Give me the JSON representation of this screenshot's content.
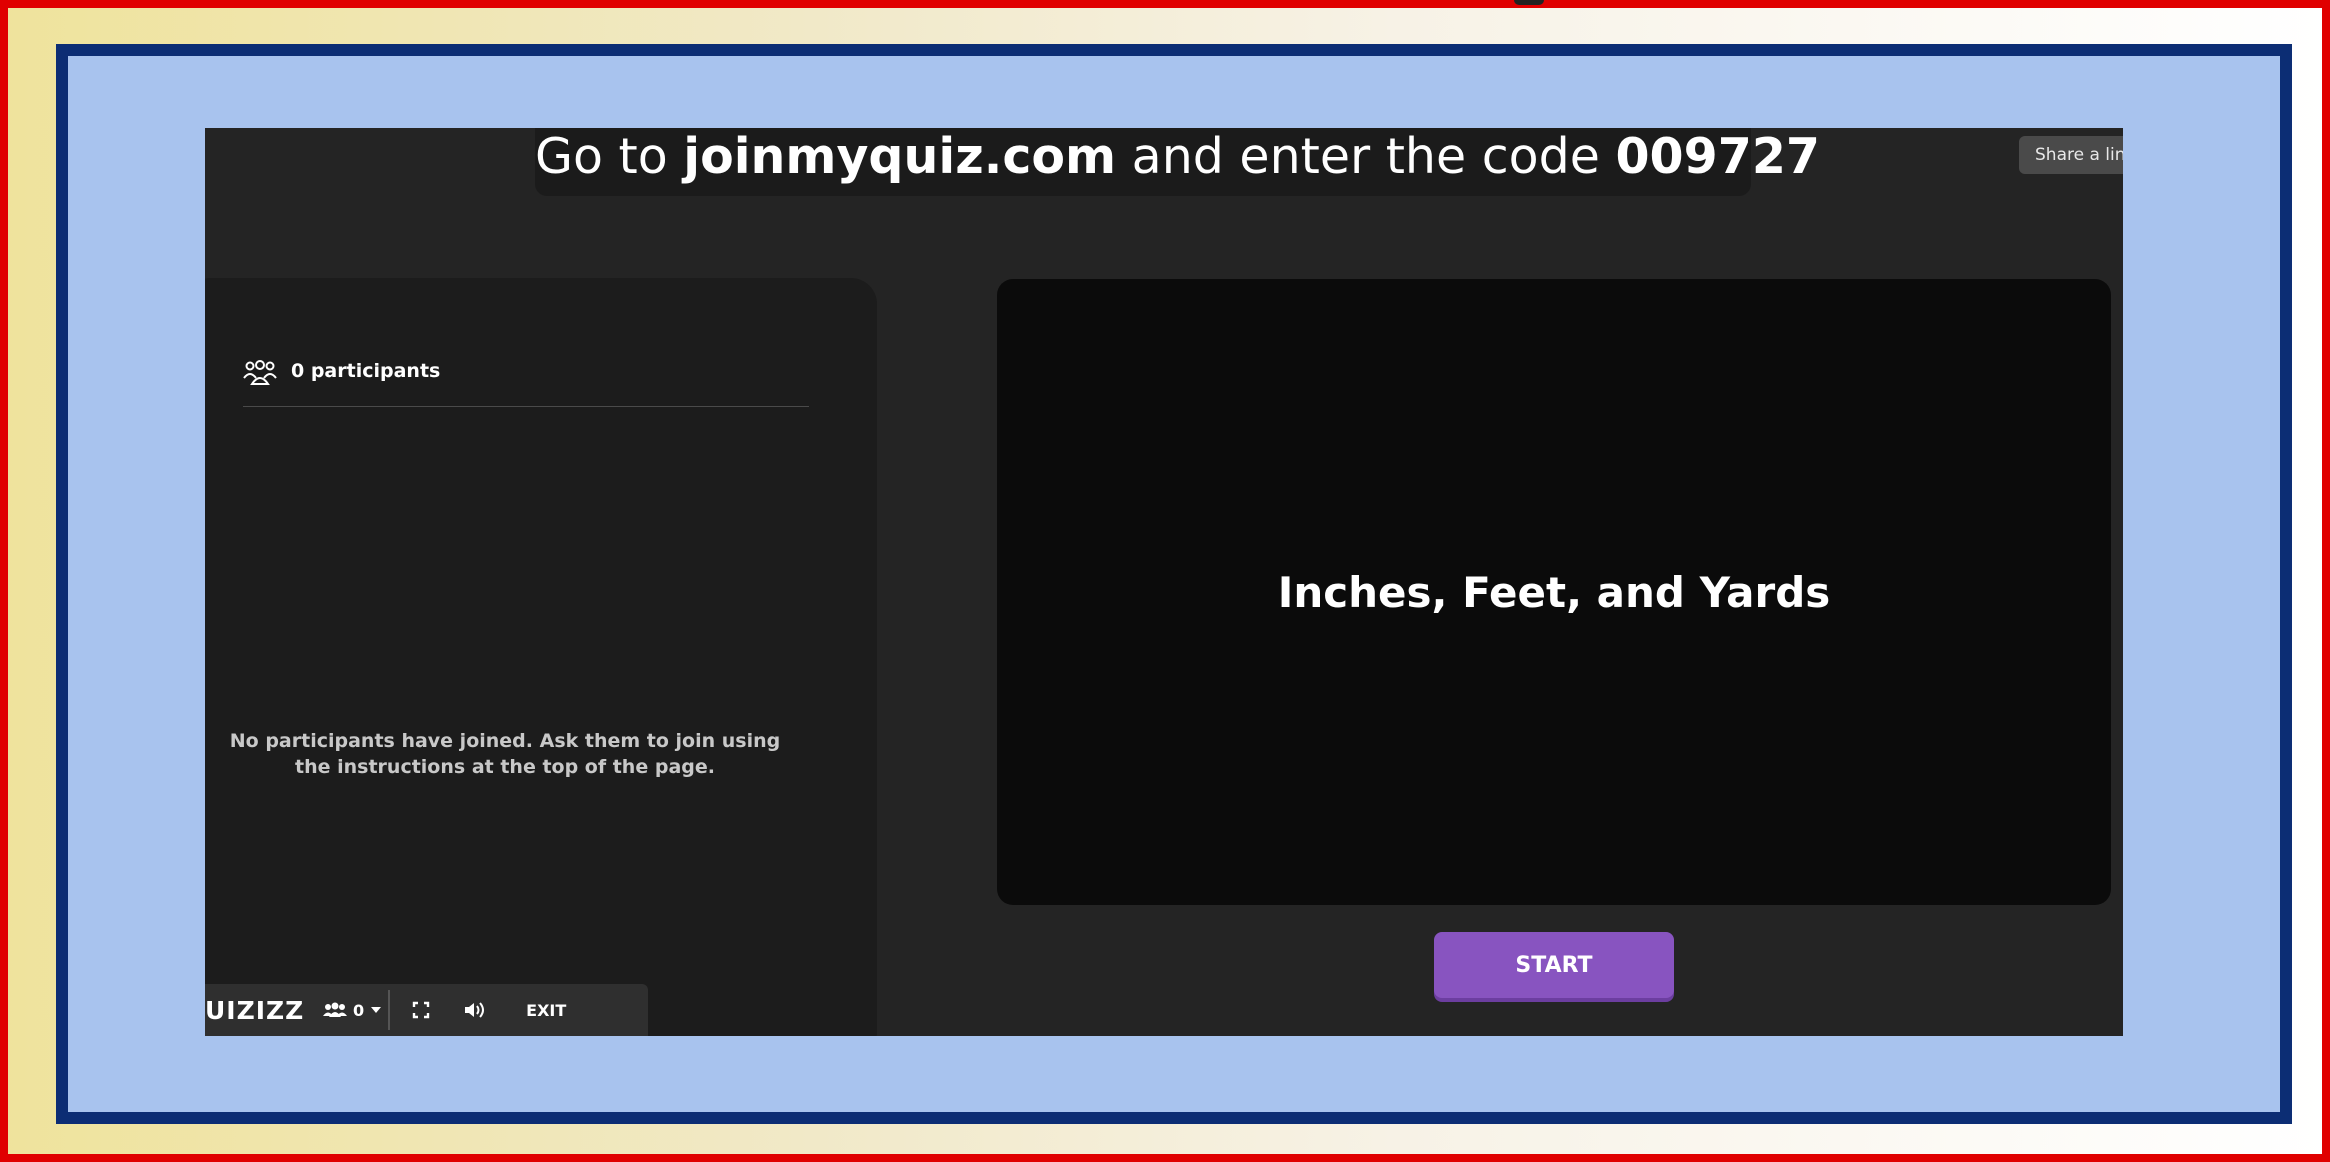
{
  "join_banner": {
    "prefix": "Go to ",
    "site": "joinmyquiz.com",
    "middle": " and enter the code ",
    "code": "009727"
  },
  "share_button": {
    "label": "Share a link"
  },
  "participants": {
    "count_label": "0 participants",
    "empty_message": "No participants have joined. Ask them to join using the instructions at the top of the page."
  },
  "quiz": {
    "title": "Inches, Feet, and Yards"
  },
  "start_button": {
    "label": "START"
  },
  "bottom_bar": {
    "brand": "UIZIZZ",
    "player_count": "0",
    "exit_label": "EXIT"
  },
  "colors": {
    "outer_border": "#e00000",
    "inner_border": "#0c2d74",
    "inner_background": "#a8c3ee",
    "start_button": "#8854c0"
  },
  "icons": [
    "people-icon",
    "chevron-down-icon",
    "fullscreen-icon",
    "volume-icon"
  ]
}
